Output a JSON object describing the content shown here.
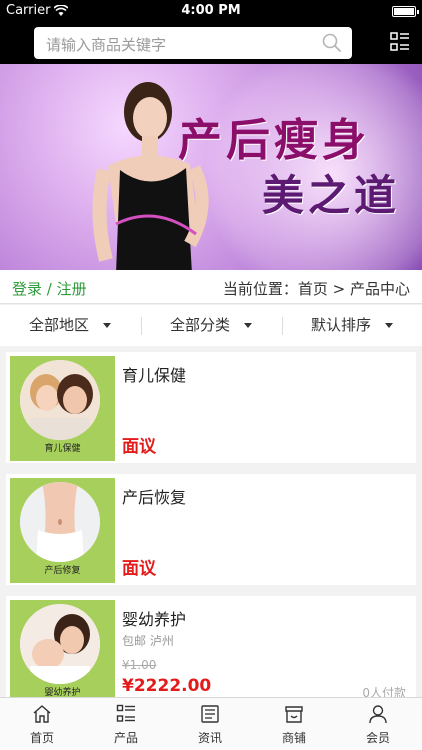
{
  "status": {
    "carrier": "Carrier",
    "time": "4:00 PM"
  },
  "search": {
    "placeholder": "请输入商品关键字"
  },
  "banner": {
    "title_line1": "产后瘦身",
    "title_line2": "美之道"
  },
  "auth": {
    "login_register": "登录 / 注册"
  },
  "breadcrumb": "当前位置：首页 > 产品中心",
  "filters": [
    {
      "label": "全部地区"
    },
    {
      "label": "全部分类"
    },
    {
      "label": "默认排序"
    }
  ],
  "products": [
    {
      "name": "育儿保健",
      "thumb_label": "育儿保健",
      "price_text": "面议"
    },
    {
      "name": "产后恢复",
      "thumb_label": "产后修复",
      "price_text": "面议"
    },
    {
      "name": "婴幼养护",
      "thumb_label": "婴幼养护",
      "shipping": "包邮 泸州",
      "old_price": "¥1.00",
      "price": "¥2222.00",
      "paid": "0人付款"
    }
  ],
  "tabs": [
    {
      "label": "首页",
      "icon": "home-icon"
    },
    {
      "label": "产品",
      "icon": "list-icon"
    },
    {
      "label": "资讯",
      "icon": "news-icon"
    },
    {
      "label": "商铺",
      "icon": "store-icon"
    },
    {
      "label": "会员",
      "icon": "user-icon"
    }
  ],
  "colors": {
    "accent_green": "#2f9b3b",
    "price_red": "#e41b1b",
    "thumb_green": "#a6cf5c"
  }
}
